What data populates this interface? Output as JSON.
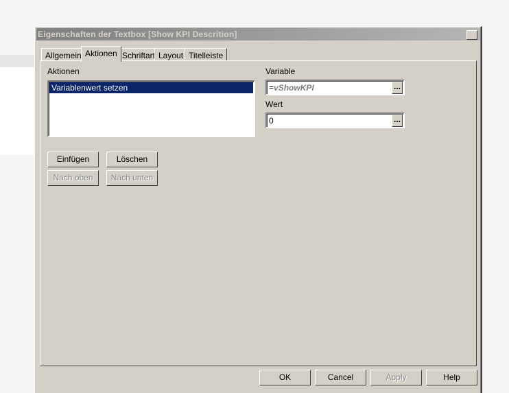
{
  "dialog": {
    "title": "Eigenschaften der Textbox [Show KPI Descrition]",
    "close": "X"
  },
  "tabs": [
    "Allgemein",
    "Aktionen",
    "Schriftart",
    "Layout",
    "Titelleiste"
  ],
  "actions": {
    "label": "Aktionen",
    "items": [
      "Variablenwert setzen"
    ]
  },
  "variable": {
    "label": "Variable",
    "prefix": "=",
    "value": "vShowKPI",
    "browse": "..."
  },
  "wert": {
    "label": "Wert",
    "value": "0",
    "browse": "..."
  },
  "buttons": {
    "insert": "Einfügen",
    "delete": "Löschen",
    "up": "Nach oben",
    "down": "Nach unten"
  },
  "footer": {
    "ok": "OK",
    "cancel": "Cancel",
    "apply": "Apply",
    "help": "Help"
  }
}
